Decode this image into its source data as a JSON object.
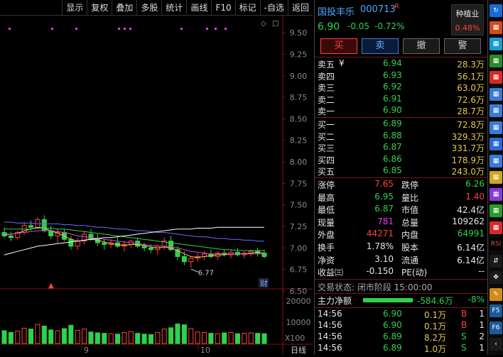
{
  "toolbar": [
    "显示",
    "复权",
    "叠加",
    "多股",
    "统计",
    "画线",
    "F10",
    "标记",
    "-自选",
    "返回"
  ],
  "chart_data": {
    "type": "candlestick",
    "price_ticks": [
      "9.50",
      "9.25",
      "9.00",
      "8.75",
      "8.50",
      "8.25",
      "8.00",
      "7.75",
      "7.50",
      "7.25",
      "7.00",
      "6.75",
      "6.50"
    ],
    "price_range": [
      6.5,
      9.6
    ],
    "low_marker": "6.77",
    "volume_ticks": [
      "20000",
      "10000"
    ],
    "volume_unit": "X100",
    "date_labels": [
      "9",
      "10"
    ],
    "period_label": "日线",
    "finance_badge": "财",
    "candles": [
      {
        "o": 7.18,
        "h": 7.24,
        "l": 7.12,
        "c": 7.14
      },
      {
        "o": 7.14,
        "h": 7.19,
        "l": 7.08,
        "c": 7.12
      },
      {
        "o": 7.12,
        "h": 7.2,
        "l": 7.1,
        "c": 7.18
      },
      {
        "o": 7.18,
        "h": 7.3,
        "l": 7.15,
        "c": 7.26
      },
      {
        "o": 7.26,
        "h": 7.32,
        "l": 7.2,
        "c": 7.24
      },
      {
        "o": 7.24,
        "h": 7.36,
        "l": 7.22,
        "c": 7.33
      },
      {
        "o": 7.33,
        "h": 7.38,
        "l": 7.18,
        "c": 7.2
      },
      {
        "o": 7.2,
        "h": 7.26,
        "l": 7.1,
        "c": 7.14
      },
      {
        "o": 7.14,
        "h": 7.22,
        "l": 7.06,
        "c": 7.18
      },
      {
        "o": 7.18,
        "h": 7.22,
        "l": 7.08,
        "c": 7.1
      },
      {
        "o": 7.1,
        "h": 7.14,
        "l": 6.98,
        "c": 7.02
      },
      {
        "o": 7.02,
        "h": 7.12,
        "l": 6.98,
        "c": 7.08
      },
      {
        "o": 7.08,
        "h": 7.2,
        "l": 7.04,
        "c": 7.16
      },
      {
        "o": 7.16,
        "h": 7.22,
        "l": 7.08,
        "c": 7.1
      },
      {
        "o": 7.1,
        "h": 7.16,
        "l": 7.02,
        "c": 7.06
      },
      {
        "o": 7.06,
        "h": 7.1,
        "l": 6.98,
        "c": 7.04
      },
      {
        "o": 7.04,
        "h": 7.1,
        "l": 7.0,
        "c": 7.06
      },
      {
        "o": 7.06,
        "h": 7.12,
        "l": 7.0,
        "c": 7.02
      },
      {
        "o": 7.02,
        "h": 7.08,
        "l": 6.96,
        "c": 7.04
      },
      {
        "o": 7.04,
        "h": 7.1,
        "l": 7.0,
        "c": 7.08
      },
      {
        "o": 7.08,
        "h": 7.12,
        "l": 7.0,
        "c": 7.02
      },
      {
        "o": 7.02,
        "h": 7.06,
        "l": 6.96,
        "c": 7.0
      },
      {
        "o": 7.0,
        "h": 7.04,
        "l": 6.94,
        "c": 6.98
      },
      {
        "o": 6.98,
        "h": 7.04,
        "l": 6.92,
        "c": 7.02
      },
      {
        "o": 7.02,
        "h": 7.12,
        "l": 6.98,
        "c": 7.08
      },
      {
        "o": 7.08,
        "h": 7.14,
        "l": 6.96,
        "c": 6.98
      },
      {
        "o": 6.98,
        "h": 7.02,
        "l": 6.86,
        "c": 6.9
      },
      {
        "o": 6.9,
        "h": 6.96,
        "l": 6.8,
        "c": 6.84
      },
      {
        "o": 6.84,
        "h": 6.9,
        "l": 6.77,
        "c": 6.88
      },
      {
        "o": 6.88,
        "h": 6.94,
        "l": 6.84,
        "c": 6.9
      },
      {
        "o": 6.9,
        "h": 6.96,
        "l": 6.86,
        "c": 6.93
      },
      {
        "o": 6.93,
        "h": 6.98,
        "l": 6.88,
        "c": 6.9
      },
      {
        "o": 6.9,
        "h": 6.96,
        "l": 6.86,
        "c": 6.94
      },
      {
        "o": 6.94,
        "h": 6.98,
        "l": 6.9,
        "c": 6.92
      },
      {
        "o": 6.92,
        "h": 6.98,
        "l": 6.88,
        "c": 6.95
      },
      {
        "o": 6.95,
        "h": 7.0,
        "l": 6.9,
        "c": 6.92
      },
      {
        "o": 6.92,
        "h": 6.96,
        "l": 6.88,
        "c": 6.94
      },
      {
        "o": 6.94,
        "h": 6.98,
        "l": 6.9,
        "c": 6.96
      },
      {
        "o": 6.96,
        "h": 7.0,
        "l": 6.9,
        "c": 6.94
      },
      {
        "o": 6.94,
        "h": 6.98,
        "l": 6.88,
        "c": 6.9
      }
    ],
    "ma_series": [
      {
        "color": "#e8c84a",
        "values": [
          7.15,
          7.16,
          7.17,
          7.2,
          7.22,
          7.24,
          7.23,
          7.2,
          7.17,
          7.14,
          7.1,
          7.08,
          7.09,
          7.1,
          7.09,
          7.07,
          7.05,
          7.04,
          7.03,
          7.04,
          7.04,
          7.03,
          7.01,
          7.0,
          7.01,
          7.0,
          6.97,
          6.93,
          6.9,
          6.89,
          6.9,
          6.91,
          6.92,
          6.92,
          6.93,
          6.93,
          6.93,
          6.94,
          6.95,
          6.94
        ]
      },
      {
        "color": "#e040e0",
        "values": [
          7.16,
          7.16,
          7.17,
          7.18,
          7.19,
          7.2,
          7.2,
          7.2,
          7.19,
          7.18,
          7.16,
          7.14,
          7.13,
          7.12,
          7.11,
          7.1,
          7.09,
          7.08,
          7.07,
          7.06,
          7.05,
          7.04,
          7.03,
          7.02,
          7.02,
          7.01,
          7.0,
          6.98,
          6.96,
          6.95,
          6.94,
          6.93,
          6.93,
          6.93,
          6.93,
          6.93,
          6.93,
          6.93,
          6.93,
          6.93
        ]
      },
      {
        "color": "#2fd24b",
        "values": [
          7.22,
          7.22,
          7.22,
          7.22,
          7.22,
          7.23,
          7.23,
          7.23,
          7.22,
          7.22,
          7.21,
          7.2,
          7.19,
          7.18,
          7.17,
          7.16,
          7.15,
          7.14,
          7.13,
          7.12,
          7.11,
          7.1,
          7.09,
          7.08,
          7.07,
          7.06,
          7.05,
          7.04,
          7.03,
          7.02,
          7.01,
          7.0,
          6.99,
          6.98,
          6.98,
          6.97,
          6.97,
          6.97,
          6.97,
          6.97
        ]
      },
      {
        "color": "#6a6aff",
        "values": [
          7.3,
          7.3,
          7.29,
          7.29,
          7.29,
          7.28,
          7.28,
          7.28,
          7.28,
          7.27,
          7.27,
          7.26,
          7.26,
          7.25,
          7.24,
          7.24,
          7.23,
          7.22,
          7.22,
          7.21,
          7.2,
          7.2,
          7.19,
          7.18,
          7.18,
          7.17,
          7.16,
          7.15,
          7.14,
          7.13,
          7.13,
          7.12,
          7.11,
          7.11,
          7.1,
          7.1,
          7.09,
          7.09,
          7.08,
          7.08
        ]
      },
      {
        "color": "#ffffff",
        "values": [
          6.92,
          6.94,
          6.96,
          6.98,
          7.0,
          7.02,
          7.03,
          7.04,
          7.05,
          7.06,
          7.07,
          7.08,
          7.09,
          7.1,
          7.11,
          7.12,
          7.12,
          7.13,
          7.14,
          7.15,
          7.16,
          7.17,
          7.18,
          7.19,
          7.2,
          7.21,
          7.22,
          7.22,
          7.22,
          7.23,
          7.23,
          7.23,
          7.24,
          7.24,
          7.24,
          7.24,
          7.24,
          7.24,
          7.24,
          7.24
        ]
      }
    ],
    "volumes": [
      6000,
      5200,
      5800,
      7200,
      6800,
      9000,
      8200,
      6400,
      6000,
      7000,
      8600,
      6200,
      6800,
      5400,
      5000,
      4800,
      4600,
      4400,
      5200,
      5600,
      4800,
      4400,
      4200,
      5200,
      6800,
      7400,
      9200,
      8800,
      7000,
      5400,
      5200,
      4800,
      4600,
      5000,
      5200,
      4600,
      4800,
      5000,
      4800,
      4600
    ]
  },
  "stock": {
    "name": "国投丰乐",
    "code": "000713",
    "flag": "R",
    "price": "6.90",
    "change": "-0.05",
    "pct": "-0.72%",
    "sector": "种植业",
    "sector_pct": "0.48%"
  },
  "actions": [
    "买",
    "卖",
    "撤",
    "警"
  ],
  "asks": [
    {
      "label": "卖五",
      "mark": "¥",
      "price": "6.94",
      "vol": "28.3万"
    },
    {
      "label": "卖四",
      "mark": "",
      "price": "6.93",
      "vol": "56.1万"
    },
    {
      "label": "卖三",
      "mark": "",
      "price": "6.92",
      "vol": "63.0万"
    },
    {
      "label": "卖二",
      "mark": "",
      "price": "6.91",
      "vol": "72.6万"
    },
    {
      "label": "卖一",
      "mark": "",
      "price": "6.90",
      "vol": "28.7万"
    }
  ],
  "bids": [
    {
      "label": "买一",
      "price": "6.89",
      "vol": "72.8万"
    },
    {
      "label": "买二",
      "price": "6.88",
      "vol": "329.3万"
    },
    {
      "label": "买三",
      "price": "6.87",
      "vol": "331.7万"
    },
    {
      "label": "买四",
      "price": "6.86",
      "vol": "178.9万"
    },
    {
      "label": "买五",
      "price": "6.85",
      "vol": "243.0万"
    }
  ],
  "stats": [
    {
      "l1": "涨停",
      "v1": "7.65",
      "c1": "red",
      "l2": "跌停",
      "v2": "6.26",
      "c2": "green"
    },
    {
      "l1": "最高",
      "v1": "6.95",
      "c1": "green",
      "l2": "量比",
      "v2": "1.40",
      "c2": "red"
    },
    {
      "l1": "最低",
      "v1": "6.87",
      "c1": "green",
      "l2": "市值",
      "v2": "42.4亿",
      "c2": "white"
    },
    {
      "l1": "现量",
      "v1": "781",
      "c1": "purple",
      "l2": "总量",
      "v2": "109262",
      "c2": "white"
    },
    {
      "l1": "外盘",
      "v1": "44271",
      "c1": "red",
      "l2": "内盘",
      "v2": "64991",
      "c2": "green"
    },
    {
      "l1": "换手",
      "v1": "1.78%",
      "c1": "white",
      "l2": "股本",
      "v2": "6.14亿",
      "c2": "white"
    },
    {
      "l1": "净资",
      "v1": "3.10",
      "c1": "white",
      "l2": "流通",
      "v2": "6.14亿",
      "c2": "white"
    },
    {
      "l1": "收益㈢",
      "v1": "-0.150",
      "c1": "white",
      "l2": "PE(动)",
      "v2": "--",
      "c2": "white"
    }
  ],
  "trade_status": "交易状态: 闭市阶段 15:00:00",
  "main_flow": {
    "label": "主力净额",
    "value": "-584.6万",
    "pct": "-8%"
  },
  "ticks": [
    {
      "time": "14:56",
      "price": "6.90",
      "vol": "0.1万",
      "side": "B",
      "n": "1"
    },
    {
      "time": "14:56",
      "price": "6.90",
      "vol": "0.1万",
      "side": "B",
      "n": "1"
    },
    {
      "time": "14:56",
      "price": "6.89",
      "vol": "8.2万",
      "side": "S",
      "n": "2"
    },
    {
      "time": "14:56",
      "price": "6.89",
      "vol": "1.0万",
      "side": "S",
      "n": "1"
    }
  ],
  "sidebar_icons": [
    "refresh-icon",
    "grid-icon",
    "list-icon",
    "chart-icon",
    "kline-icon",
    "bars-icon",
    "table-icon",
    "table2-icon",
    "layout-icon",
    "bars2-icon",
    "pie-icon",
    "block-icon",
    "timeshare-icon",
    "bars3-icon",
    "rsi-icon",
    "sort-icon",
    "move-icon",
    "pencil-icon",
    "f5-icon",
    "f6-icon",
    "collapse-icon"
  ],
  "sidebar_text": {
    "rsi": "RSI",
    "f5": "F5",
    "f6": "F6"
  },
  "colors": {
    "up": "#ff4040",
    "down": "#2fd24b",
    "axis": "#7a1515",
    "bg": "#000000"
  }
}
